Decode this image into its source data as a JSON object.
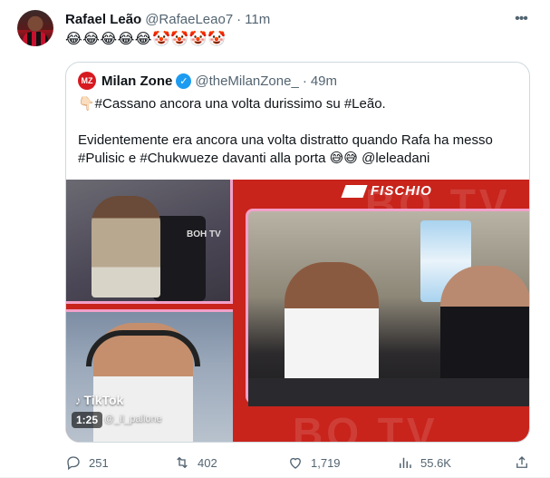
{
  "tweet": {
    "author_name": "Rafael Leão",
    "author_handle": "@RafaeLeao7",
    "separator": "·",
    "time": "11m",
    "more_icon": "more-dots-icon",
    "text": "😂😂😂😂😂🤡🤡🤡🤡"
  },
  "quote": {
    "logo_text": "MZ",
    "author_name": "Milan Zone",
    "author_handle": "@theMilanZone_",
    "separator": "·",
    "time": "49m",
    "line1": "👇🏻#Cassano ancora una volta durissimo su #Leão.",
    "line2": "Evidentemente era ancora una volta distratto quando Rafa ha messo",
    "line3": "#Pulisic e #Chukwueze davanti alla porta 😅😅 @leleadani",
    "video": {
      "overlay_brand": "FISCHIO",
      "panel_text": "BOH TV",
      "bg_text": "BO TV",
      "tiktok_label": "TikTok",
      "tiktok_user": "@_il_pallone",
      "duration": "1:25"
    }
  },
  "actions": {
    "replies": "251",
    "reposts": "402",
    "likes": "1,719",
    "views": "55.6K"
  },
  "colors": {
    "verified": "#1d9bf0",
    "secondary_text": "#536471",
    "border": "#cfd9de",
    "video_red": "#c8241c"
  }
}
